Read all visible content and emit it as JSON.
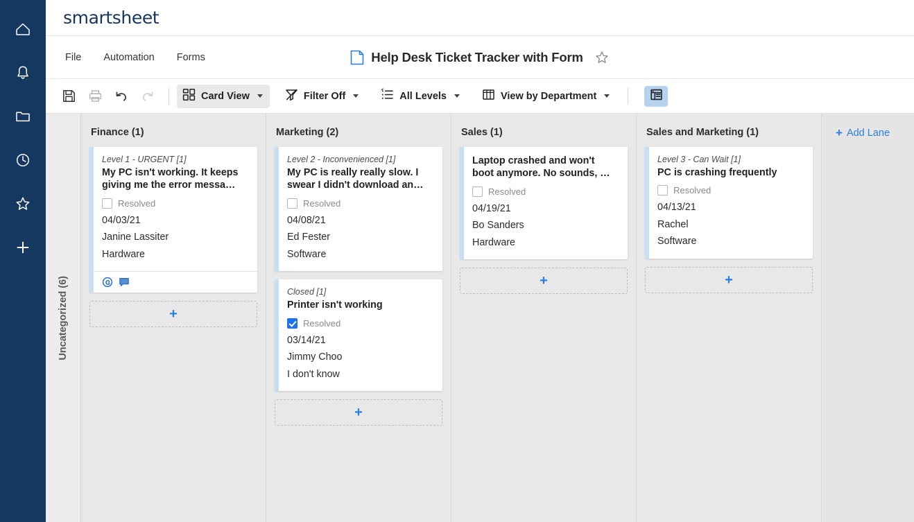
{
  "nav_rail": {
    "items": [
      {
        "icon": "home-icon"
      },
      {
        "icon": "bell-icon"
      },
      {
        "icon": "folder-icon"
      },
      {
        "icon": "clock-icon"
      },
      {
        "icon": "star-icon"
      },
      {
        "icon": "plus-icon"
      }
    ]
  },
  "brand": {
    "name": "smartsheet",
    "color": "#16365e"
  },
  "menu": {
    "items": [
      {
        "label": "File"
      },
      {
        "label": "Automation"
      },
      {
        "label": "Forms"
      }
    ],
    "document_title": "Help Desk Ticket Tracker with Form",
    "favorite_icon": "star-outline-icon",
    "doc_icon": "sheet-icon"
  },
  "toolbar": {
    "save_icon": "save-icon",
    "print_icon": "print-icon",
    "undo_icon": "undo-icon",
    "redo_icon": "redo-icon",
    "view_label": "Card View",
    "view_icon": "card-view-icon",
    "filter_label": "Filter Off",
    "filter_icon": "filter-icon",
    "levels_label": "All Levels",
    "levels_icon": "levels-icon",
    "group_label": "View by Department",
    "group_icon": "columns-icon",
    "grid_toggle_icon": "grid-view-icon",
    "accent": "#2a7de1",
    "toggle_bg": "#b5d3f0"
  },
  "board": {
    "uncategorized_label": "Uncategorized (6)",
    "add_lane_label": "Add Lane",
    "add_card_label": "+",
    "card_stripe_color": "#c5dff5",
    "lanes": [
      {
        "title": "Finance (1)",
        "cards": [
          {
            "level": "Level 1 - URGENT [1]",
            "title": "My PC isn't working. It keeps giving me the error messa…",
            "resolved_label": "Resolved",
            "resolved": false,
            "date": "04/03/21",
            "assignee": "Janine Lassiter",
            "category": "Hardware",
            "has_footer": true,
            "footer_icons": [
              "attachment-icon",
              "comment-icon"
            ]
          }
        ]
      },
      {
        "title": "Marketing (2)",
        "cards": [
          {
            "level": "Level 2 - Inconvenienced [1]",
            "title": "My PC is really really slow. I swear I didn't download an…",
            "resolved_label": "Resolved",
            "resolved": false,
            "date": "04/08/21",
            "assignee": "Ed Fester",
            "category": "Software",
            "has_footer": false,
            "footer_icons": []
          },
          {
            "level": "Closed [1]",
            "title": "Printer isn't working",
            "resolved_label": "Resolved",
            "resolved": true,
            "date": "03/14/21",
            "assignee": "Jimmy Choo",
            "category": "I don't know",
            "has_footer": false,
            "footer_icons": []
          }
        ]
      },
      {
        "title": "Sales (1)",
        "cards": [
          {
            "level": "",
            "title": "Laptop crashed and won't boot anymore. No sounds, …",
            "resolved_label": "Resolved",
            "resolved": false,
            "date": "04/19/21",
            "assignee": "Bo Sanders",
            "category": "Hardware",
            "has_footer": false,
            "footer_icons": []
          }
        ]
      },
      {
        "title": "Sales and Marketing (1)",
        "cards": [
          {
            "level": "Level 3 - Can Wait [1]",
            "title": "PC is crashing frequently",
            "resolved_label": "Resolved",
            "resolved": false,
            "date": "04/13/21",
            "assignee": "Rachel",
            "category": "Software",
            "has_footer": false,
            "footer_icons": []
          }
        ]
      }
    ]
  }
}
